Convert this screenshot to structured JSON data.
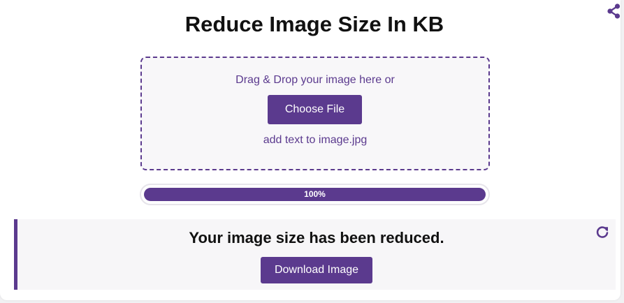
{
  "header": {
    "title": "Reduce Image Size In KB",
    "share_icon": "share-icon"
  },
  "upload": {
    "instruction": "Drag & Drop your image here or",
    "choose_button_label": "Choose File",
    "selected_file": "add text to image.jpg"
  },
  "progress": {
    "label": "100%",
    "fraction": 1.0
  },
  "result": {
    "message": "Your image size has been reduced.",
    "download_label": "Download Image",
    "reset_icon": "refresh-icon"
  },
  "colors": {
    "accent": "#5b3a8e",
    "panel_background": "#f7f6f8",
    "drop_zone_background": "#f8f7f9",
    "title_text": "#111111"
  }
}
